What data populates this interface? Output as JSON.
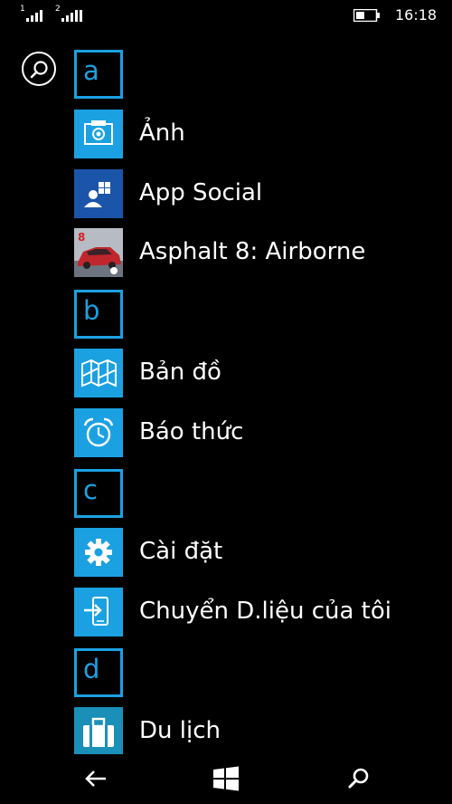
{
  "status_bar": {
    "sim1_label": "1",
    "sim2_label": "2",
    "time": "16:18",
    "signal_icon": "signal-bars-icon",
    "battery_icon": "battery-icon"
  },
  "search": {
    "icon": "search-icon"
  },
  "sections": [
    {
      "letter": "a"
    },
    {
      "letter": "b"
    },
    {
      "letter": "c"
    },
    {
      "letter": "d"
    }
  ],
  "apps": [
    {
      "name": "Ảnh",
      "icon": "camera-photo-icon"
    },
    {
      "name": "App Social",
      "icon": "app-social-icon"
    },
    {
      "name": "Asphalt 8: Airborne",
      "icon": "asphalt-8-game-icon"
    },
    {
      "name": "Bản đồ",
      "icon": "map-icon"
    },
    {
      "name": "Báo thức",
      "icon": "alarm-clock-icon"
    },
    {
      "name": "Cài đặt",
      "icon": "gear-icon"
    },
    {
      "name": "Chuyển D.liệu của tôi",
      "icon": "transfer-data-icon"
    },
    {
      "name": "Du lịch",
      "icon": "suitcase-icon"
    }
  ],
  "nav": {
    "back_icon": "back-arrow-icon",
    "start_icon": "windows-start-icon",
    "search_icon": "search-icon"
  },
  "colors": {
    "accent": "#1ba1e2",
    "app_social_tile": "#1b55a9",
    "background": "#000000",
    "text": "#ffffff"
  }
}
